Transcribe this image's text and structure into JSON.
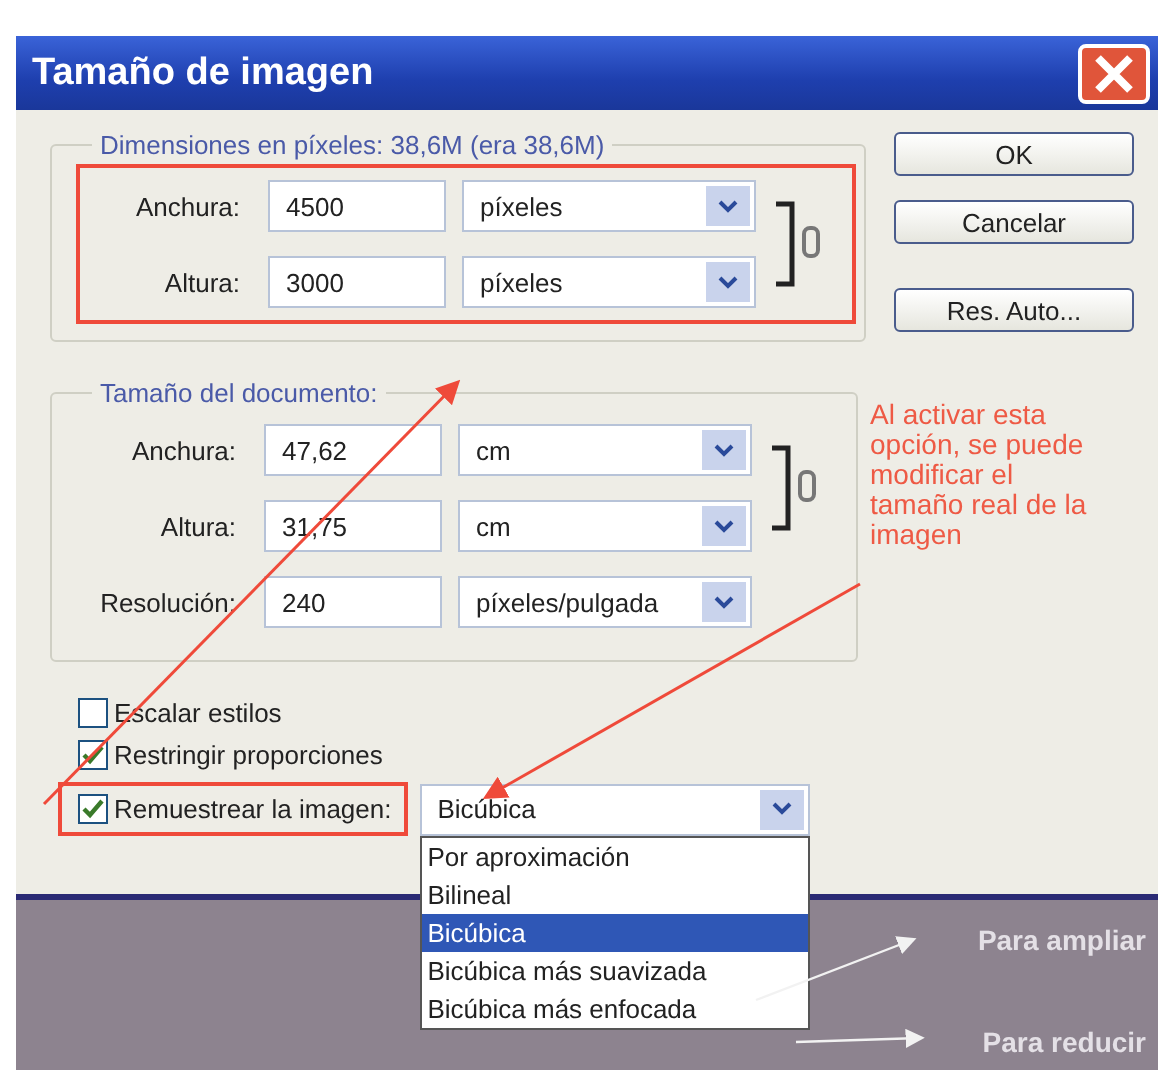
{
  "window": {
    "title": "Tamaño de imagen"
  },
  "pixel_dimensions": {
    "legend": "Dimensiones en píxeles: 38,6M (era 38,6M)",
    "rows": [
      {
        "label": "Anchura:",
        "value": "4500",
        "unit": "píxeles"
      },
      {
        "label": "Altura:",
        "value": "3000",
        "unit": "píxeles"
      }
    ]
  },
  "document_size": {
    "legend": "Tamaño del documento:",
    "rows": [
      {
        "label": "Anchura:",
        "value": "47,62",
        "unit": "cm"
      },
      {
        "label": "Altura:",
        "value": "31,75",
        "unit": "cm"
      },
      {
        "label": "Resolución:",
        "value": "240",
        "unit": "píxeles/pulgada"
      }
    ]
  },
  "buttons": [
    "OK",
    "Cancelar",
    "Res. Auto..."
  ],
  "options": [
    {
      "label": "Escalar estilos",
      "checked": false
    },
    {
      "label": "Restringir proporciones",
      "checked": true
    }
  ],
  "resample": {
    "label": "Remuestrear la imagen:",
    "checked": true,
    "value": "Bicúbica",
    "menu": [
      {
        "label": "Por aproximación",
        "selected": false
      },
      {
        "label": "Bilineal",
        "selected": false
      },
      {
        "label": "Bicúbica",
        "selected": true
      },
      {
        "label": "Bicúbica más suavizada",
        "selected": false
      },
      {
        "label": "Bicúbica más enfocada",
        "selected": false
      }
    ]
  },
  "annotations": {
    "note": "Al activar esta opción, se puede modificar el tamaño real de la imagen",
    "enlarge": "Para ampliar",
    "reduce": "Para reducir"
  }
}
